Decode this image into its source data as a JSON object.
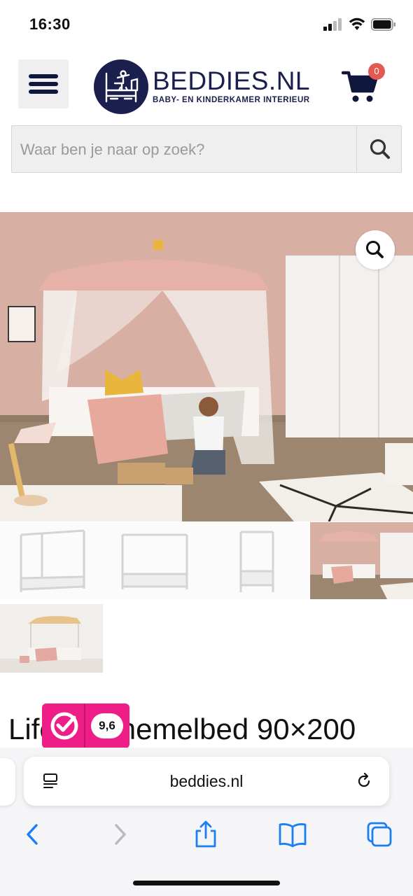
{
  "status_bar": {
    "time": "16:30"
  },
  "header": {
    "logo_text": "BEDDIES.NL",
    "logo_subtitle": "BABY- EN KINDERKAMER INTERIEUR",
    "cart_count": "0",
    "icons": {
      "menu": "hamburger-icon",
      "cart": "shopping-cart-icon"
    }
  },
  "search": {
    "placeholder": "Waar ben je naar op zoek?",
    "icon": "search-icon"
  },
  "gallery": {
    "zoom_icon": "magnifier-icon",
    "thumbnail_count": 5
  },
  "product": {
    "title": "Lifetime hemelbed 90×200"
  },
  "review_widget": {
    "score": "9,6"
  },
  "safari": {
    "url": "beddies.nl",
    "toolbar": [
      "back-icon",
      "forward-icon",
      "share-icon",
      "bookmarks-icon",
      "tabs-icon"
    ]
  },
  "colors": {
    "brand_navy": "#1b1f4d",
    "badge_red": "#e35a52",
    "kiyoh_pink": "#ee1d87",
    "safari_blue": "#1a7ef4"
  }
}
